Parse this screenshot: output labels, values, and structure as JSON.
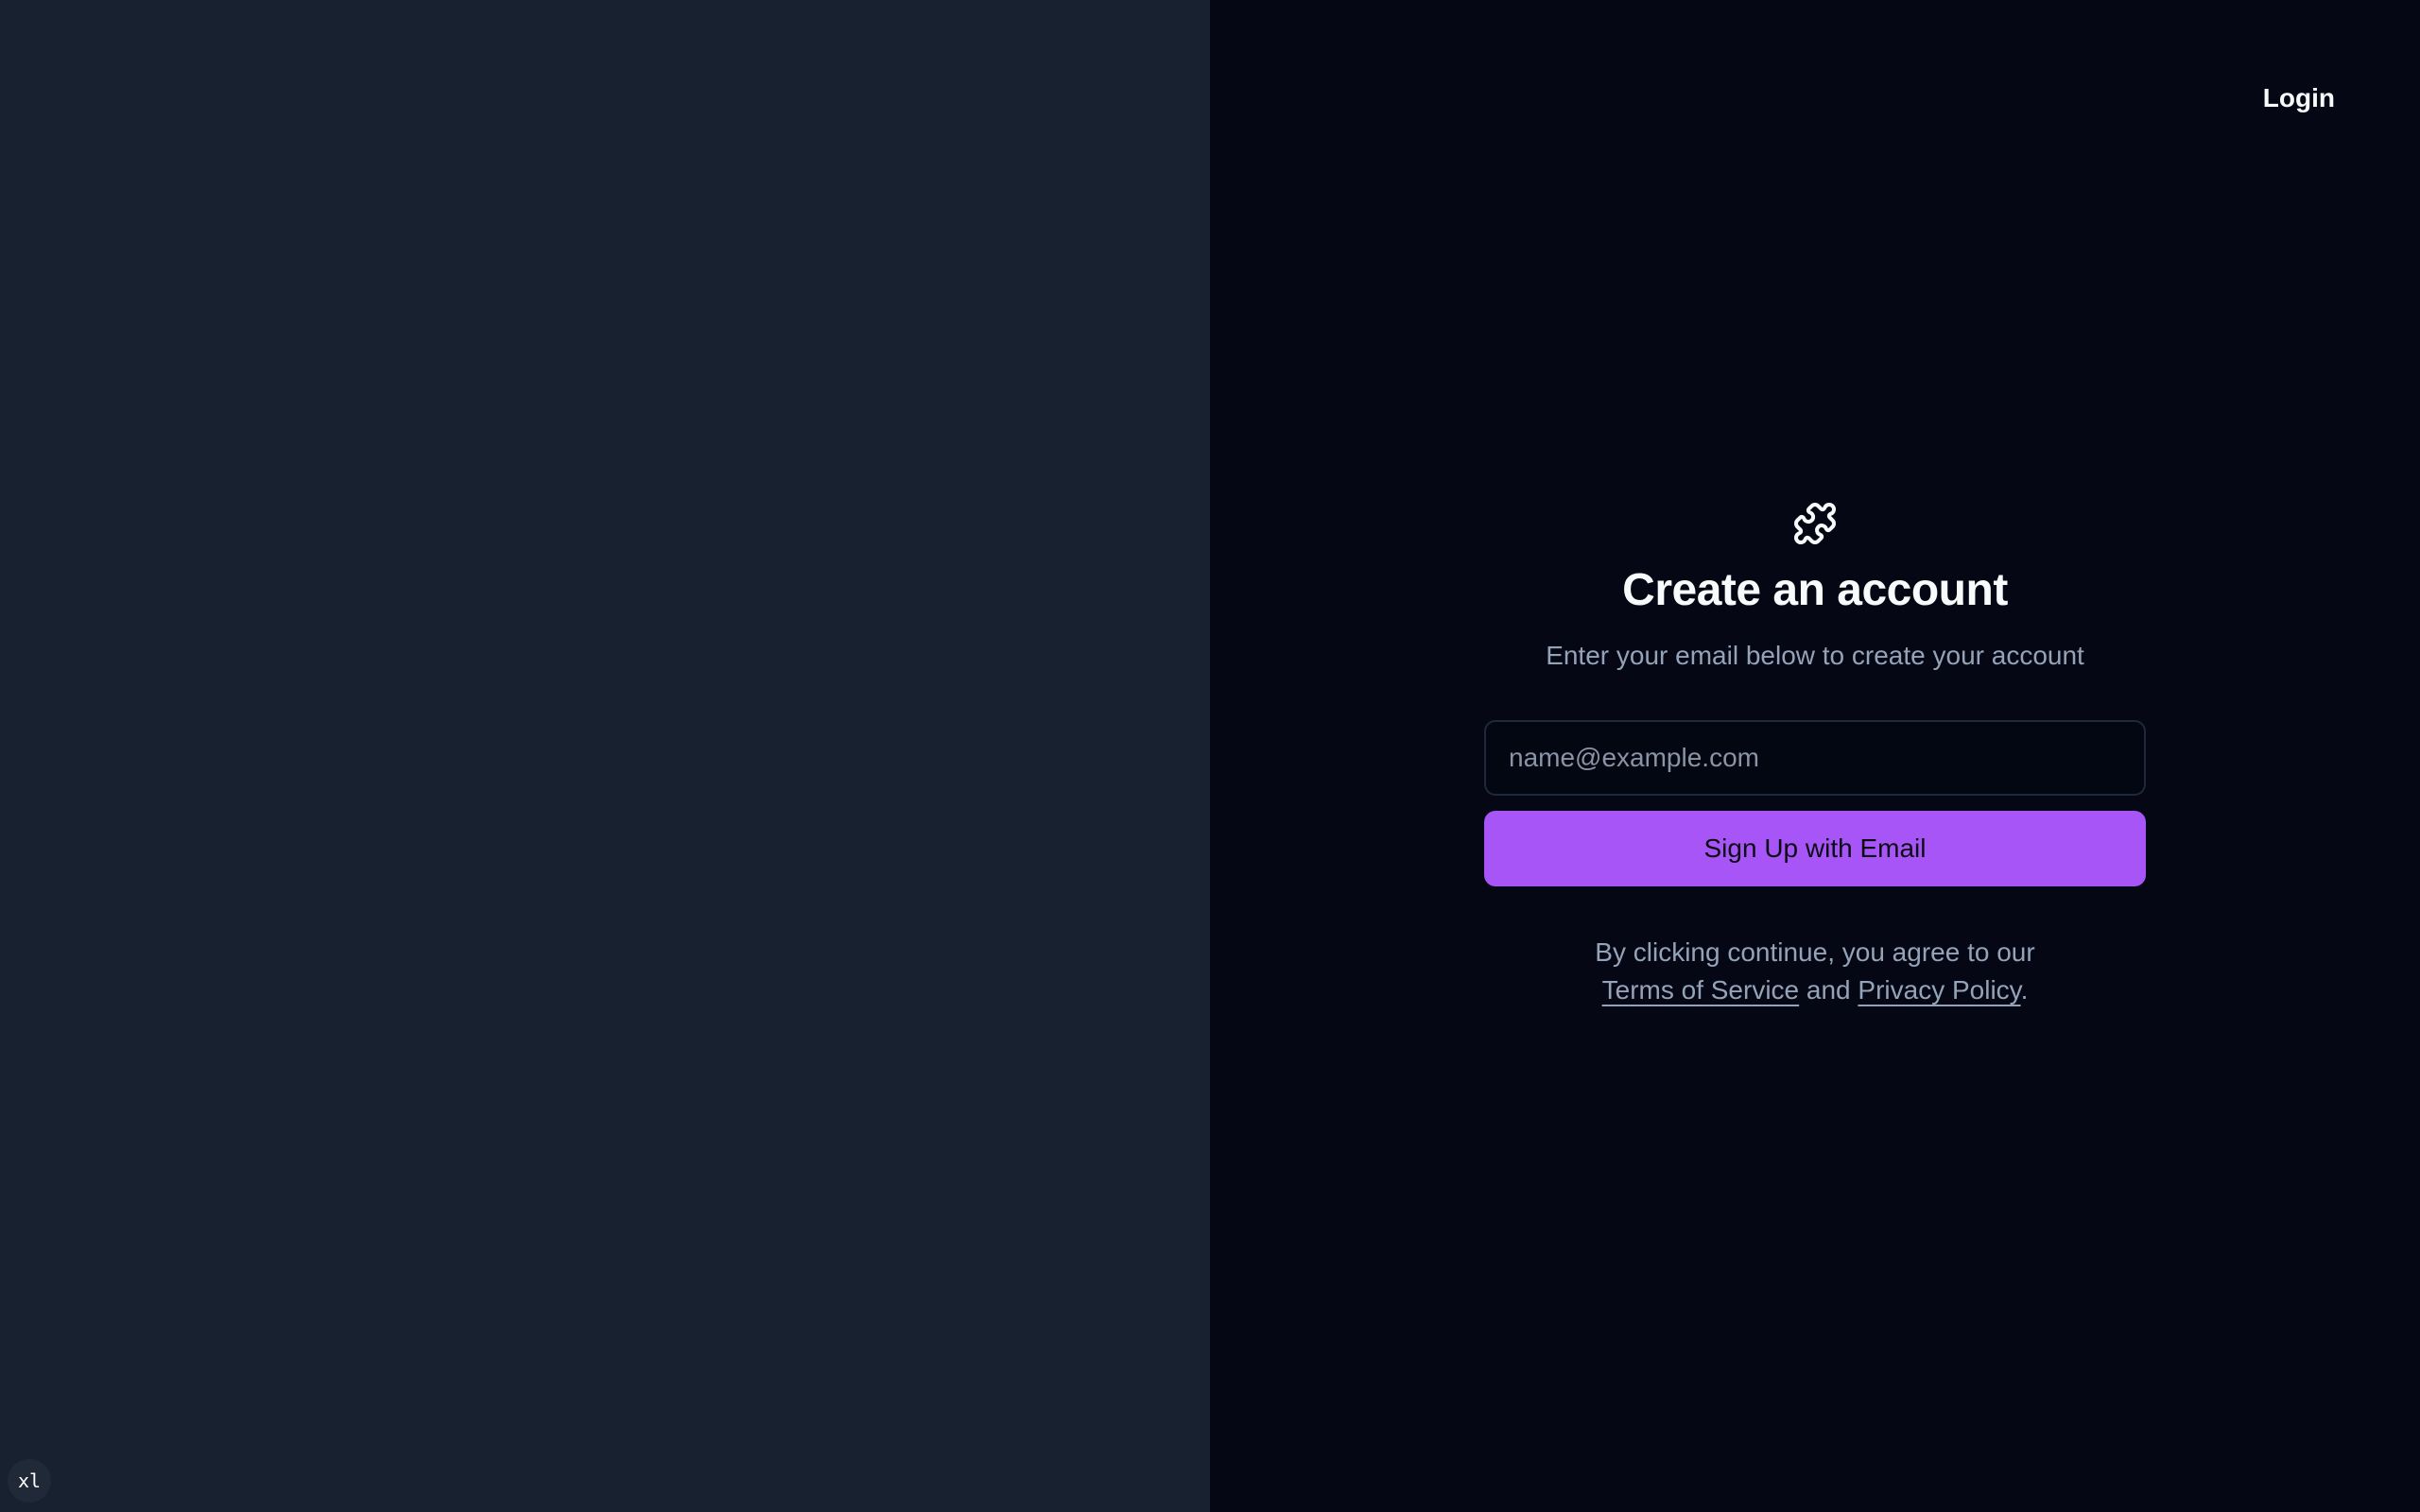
{
  "header": {
    "login_label": "Login"
  },
  "auth": {
    "logo_icon": "puzzle-icon",
    "title": "Create an account",
    "subtitle": "Enter your email below to create your account",
    "email_placeholder": "name@example.com",
    "email_value": "",
    "submit_label": "Sign Up with Email"
  },
  "legal": {
    "prefix": "By clicking continue, you agree to our",
    "terms_label": "Terms of Service",
    "conjunction": "and",
    "privacy_label": "Privacy Policy",
    "suffix": "."
  },
  "debug": {
    "breakpoint": "xl"
  },
  "colors": {
    "left_panel_bg": "#172130",
    "right_panel_bg": "#050814",
    "accent": "#a855f7",
    "muted_text": "#94a3b8",
    "input_border": "#1e293b"
  }
}
